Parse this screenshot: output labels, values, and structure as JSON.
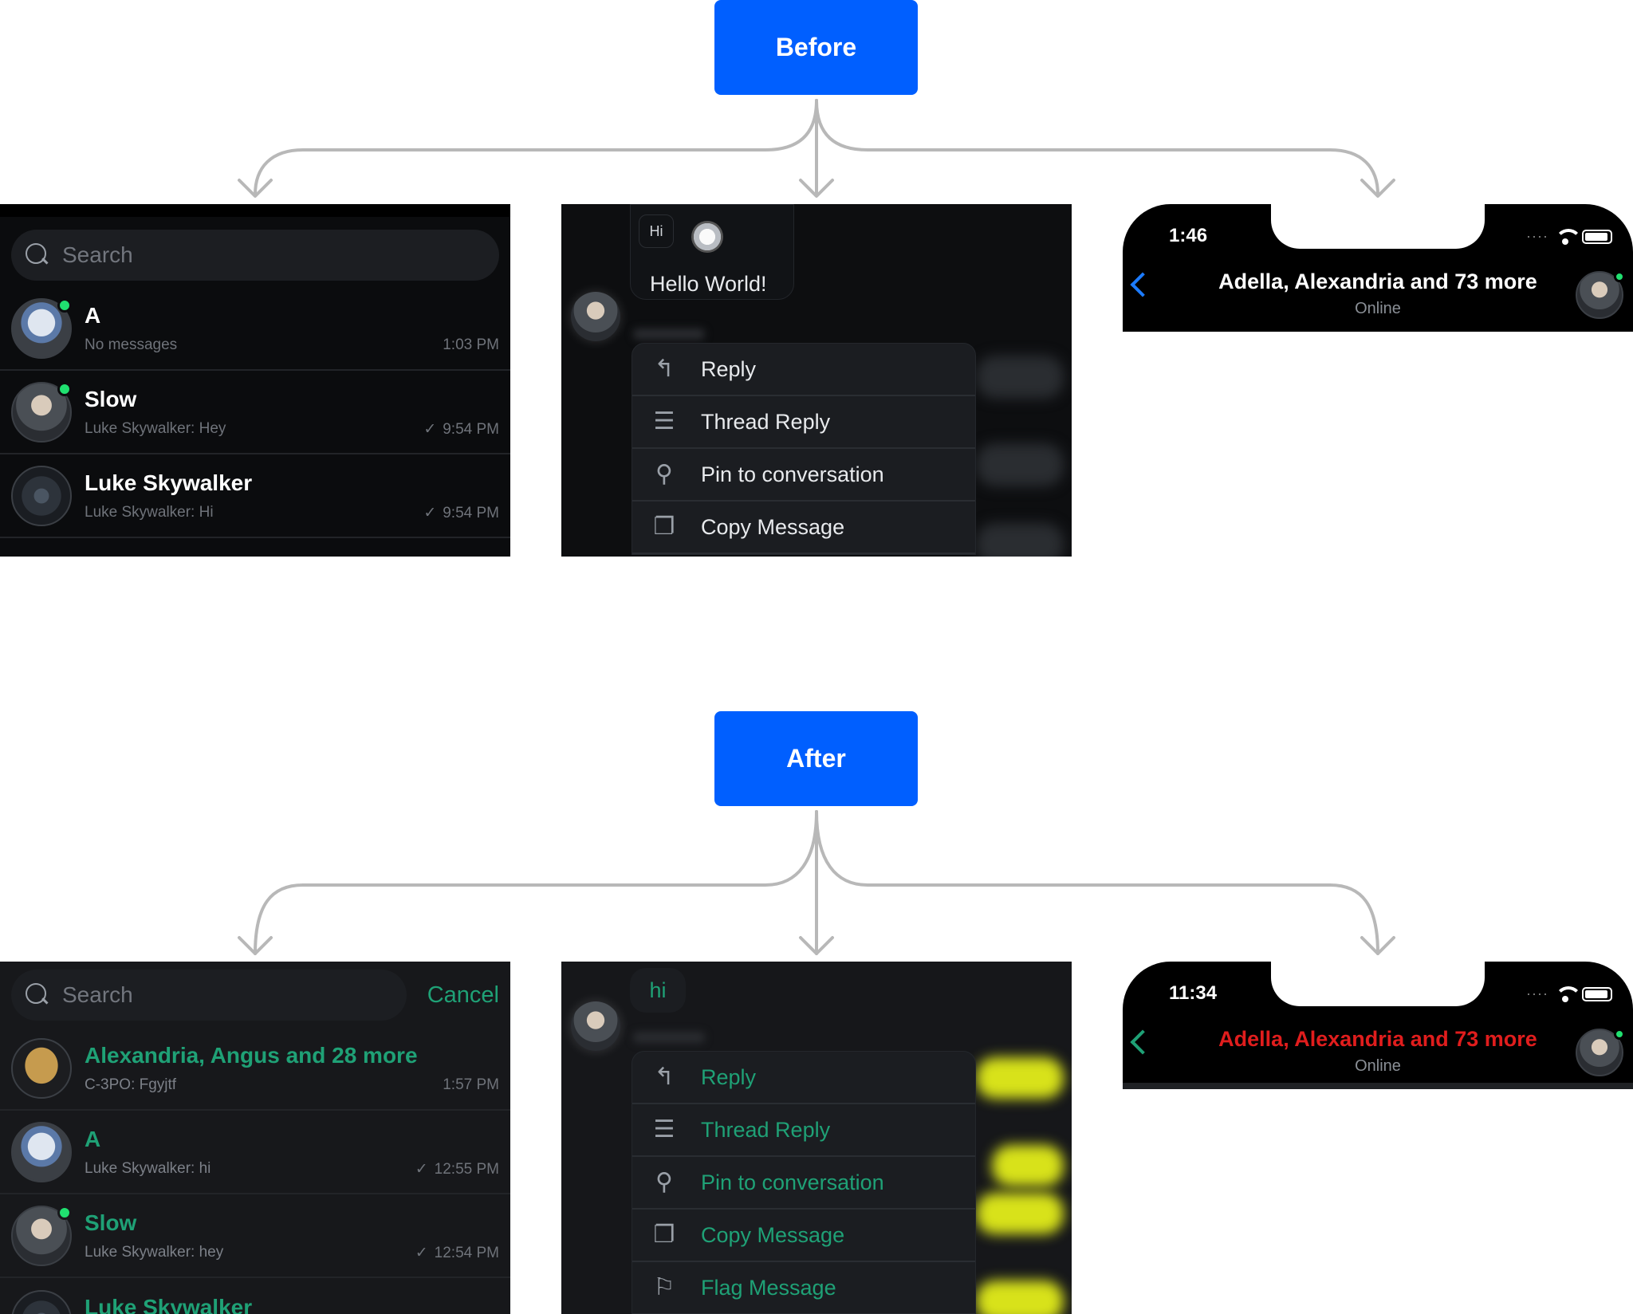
{
  "labels": {
    "before": "Before",
    "after": "After"
  },
  "colors": {
    "label_bg": "#005fff",
    "connector": "#b8b8b8",
    "accent_after": "#1fa176",
    "header_title_after": "#e01d1d",
    "back_chevron_before": "#1c7bff",
    "online": "#20e070"
  },
  "before": {
    "channel_list": {
      "search_placeholder": "Search",
      "rows": [
        {
          "name": "A",
          "preview": "No messages",
          "time": "1:03 PM",
          "online": true,
          "avatar": "r2d2-avatar"
        },
        {
          "name": "Slow",
          "preview": "Luke Skywalker: Hey",
          "time": "9:54 PM",
          "read": true,
          "online": true,
          "avatar": "leia-avatar"
        },
        {
          "name": "Luke Skywalker",
          "preview": "Luke Skywalker: Hi",
          "time": "9:54 PM",
          "read": true,
          "online": false,
          "avatar": "ship-avatar"
        }
      ]
    },
    "message": {
      "quoted": "Hi",
      "text": "Hello World!"
    },
    "menu": [
      {
        "label": "Reply",
        "icon": "reply-icon"
      },
      {
        "label": "Thread Reply",
        "icon": "thread-icon"
      },
      {
        "label": "Pin to conversation",
        "icon": "pin-icon"
      },
      {
        "label": "Copy Message",
        "icon": "copy-icon"
      }
    ],
    "header": {
      "time": "1:46",
      "title": "Adella, Alexandria and 73 more",
      "subtitle": "Online"
    }
  },
  "after": {
    "channel_list": {
      "search_placeholder": "Search",
      "cancel": "Cancel",
      "rows": [
        {
          "name": "Alexandria, Angus and 28 more",
          "preview": "C-3PO: Fgyjtf",
          "time": "1:57 PM",
          "online": false,
          "avatar": "c3po-avatar"
        },
        {
          "name": "A",
          "preview": "Luke Skywalker: hi",
          "time": "12:55 PM",
          "read": true,
          "online": false,
          "avatar": "r2d2-avatar"
        },
        {
          "name": "Slow",
          "preview": "Luke Skywalker: hey",
          "time": "12:54 PM",
          "read": true,
          "online": true,
          "avatar": "leia-avatar"
        },
        {
          "name": "Luke Skywalker",
          "preview": "",
          "time": "",
          "online": false,
          "avatar": "ship-avatar"
        }
      ]
    },
    "message": {
      "text": "hi"
    },
    "menu": [
      {
        "label": "Reply",
        "icon": "reply-icon"
      },
      {
        "label": "Thread Reply",
        "icon": "thread-icon"
      },
      {
        "label": "Pin to conversation",
        "icon": "pin-icon"
      },
      {
        "label": "Copy Message",
        "icon": "copy-icon"
      },
      {
        "label": "Flag Message",
        "icon": "flag-icon"
      }
    ],
    "header": {
      "time": "11:34",
      "title": "Adella, Alexandria and 73 more",
      "subtitle": "Online"
    }
  }
}
